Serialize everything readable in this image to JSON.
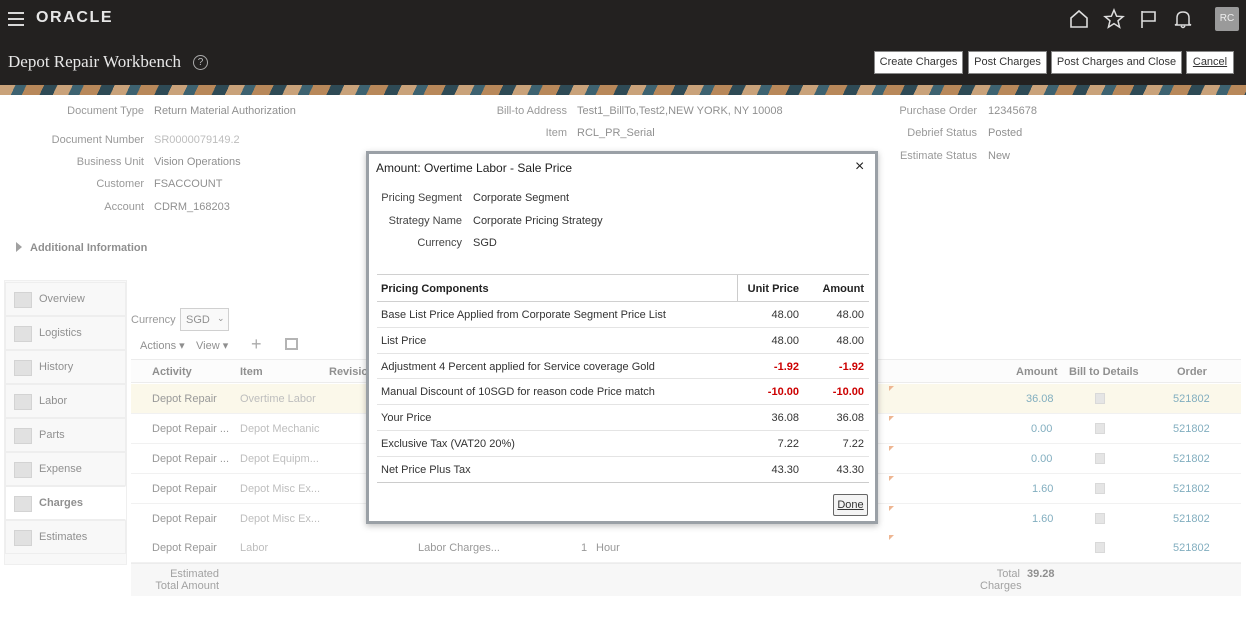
{
  "header": {
    "brand": "ORACLE",
    "avatar": "RC",
    "page_title": "Depot Repair Workbench",
    "help": "?",
    "buttons": [
      "Create Charges",
      "Post Charges",
      "Post Charges and Close",
      "Cancel"
    ],
    "icons": [
      "home-icon",
      "star-icon",
      "flag-icon",
      "bell-icon"
    ]
  },
  "form": {
    "document_type_label": "Document Type",
    "document_type": "Return Material Authorization",
    "document_number_label": "Document Number",
    "document_number": "SR0000079149.2",
    "business_unit_label": "Business Unit",
    "business_unit": "Vision Operations",
    "customer_label": "Customer",
    "customer": "FSACCOUNT",
    "account_label": "Account",
    "account": "CDRM_168203",
    "bill_to_label": "Bill-to Address",
    "bill_to": "Test1_BillTo,Test2,NEW YORK, NY 10008",
    "item_label": "Item",
    "item": "RCL_PR_Serial",
    "po_label": "Purchase Order",
    "po": "12345678",
    "debrief_label": "Debrief Status",
    "debrief": "Posted",
    "estimate_label": "Estimate Status",
    "estimate": "New",
    "additional_info": "Additional Information"
  },
  "sidebar": {
    "tabs": [
      "Overview",
      "Logistics",
      "History",
      "Labor",
      "Parts",
      "Expense",
      "Charges",
      "Estimates"
    ],
    "active": "Charges"
  },
  "charges": {
    "currency_label": "Currency",
    "currency": "SGD",
    "actions": "Actions",
    "view": "View",
    "columns": [
      "Activity",
      "Item",
      "Revisio",
      "Amount",
      "Bill to Details",
      "Order"
    ],
    "rows": [
      {
        "activity": "Depot Repair",
        "item": "Overtime Labor",
        "extra": "",
        "qty": "",
        "uom": "",
        "amount": "36.08",
        "order": "521802"
      },
      {
        "activity": "Depot Repair ...",
        "item": "Depot Mechanic",
        "extra": "",
        "qty": "",
        "uom": "",
        "amount": "0.00",
        "order": "521802"
      },
      {
        "activity": "Depot Repair ...",
        "item": "Depot Equipm...",
        "extra": "",
        "qty": "",
        "uom": "",
        "amount": "0.00",
        "order": "521802"
      },
      {
        "activity": "Depot Repair",
        "item": "Depot Misc Ex...",
        "extra": "",
        "qty": "",
        "uom": "",
        "amount": "1.60",
        "order": "521802"
      },
      {
        "activity": "Depot Repair",
        "item": "Depot Misc Ex...",
        "extra": "",
        "qty": "",
        "uom": "",
        "amount": "1.60",
        "order": "521802"
      },
      {
        "activity": "Depot Repair",
        "item": "Labor",
        "extra": "Labor Charges...",
        "qty": "1",
        "uom": "Hour",
        "amount": "",
        "order": "521802"
      }
    ],
    "footer_estimated": "Estimated",
    "footer_total_amount": "Total Amount",
    "footer_total": "Total",
    "footer_charges": "Charges",
    "footer_total_value": "39.28"
  },
  "dialog": {
    "title": "Amount: Overtime Labor - Sale Price",
    "close": "×",
    "pricing_segment_label": "Pricing Segment",
    "pricing_segment": "Corporate Segment",
    "strategy_label": "Strategy Name",
    "strategy": "Corporate Pricing Strategy",
    "currency_label": "Currency",
    "currency": "SGD",
    "table_headers": [
      "Pricing Components",
      "Unit Price",
      "Amount"
    ],
    "components": [
      {
        "name": "Base List Price Applied from Corporate Segment Price List",
        "unit": "48.00",
        "amount": "48.00"
      },
      {
        "name": "List Price",
        "unit": "48.00",
        "amount": "48.00"
      },
      {
        "name": "Adjustment 4 Percent applied for Service coverage Gold",
        "unit": "-1.92",
        "amount": "-1.92"
      },
      {
        "name": "Manual Discount of 10SGD for reason code Price match",
        "unit": "-10.00",
        "amount": "-10.00"
      },
      {
        "name": "Your Price",
        "unit": "36.08",
        "amount": "36.08"
      },
      {
        "name": "Exclusive Tax (VAT20 20%)",
        "unit": "7.22",
        "amount": "7.22"
      },
      {
        "name": "Net Price Plus Tax",
        "unit": "43.30",
        "amount": "43.30"
      }
    ],
    "done": "Done"
  }
}
